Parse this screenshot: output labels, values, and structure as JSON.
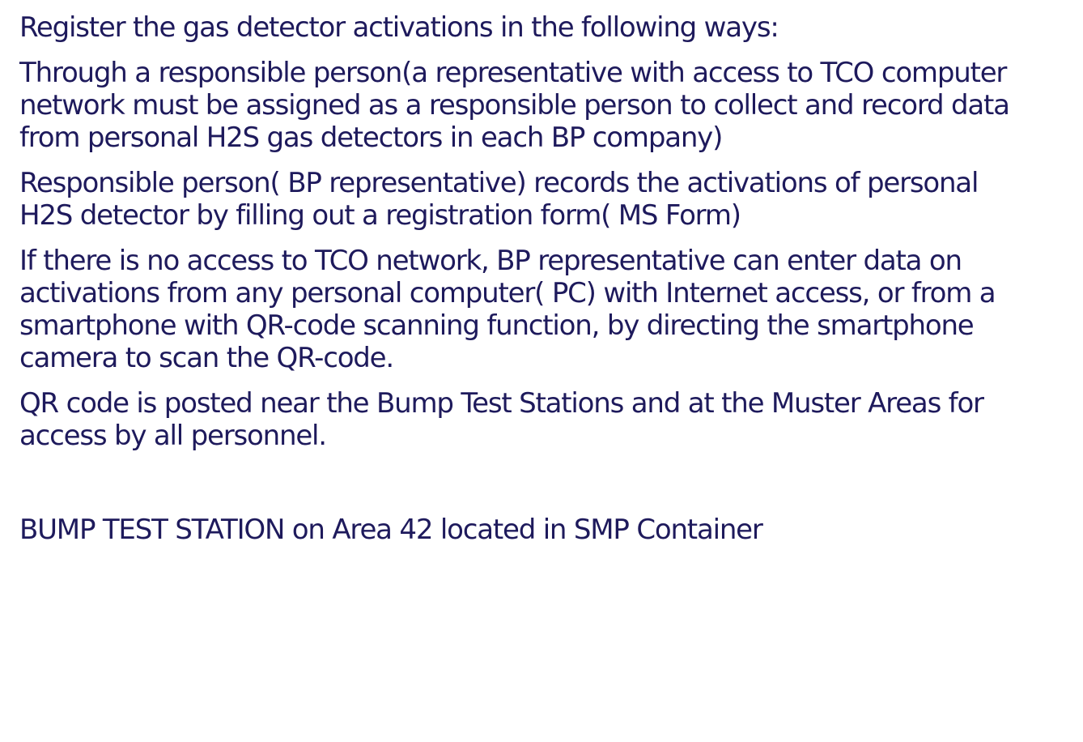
{
  "document": {
    "heading": "Register the gas detector activations in the following ways:",
    "paragraphs": [
      "Through a responsible person(a representative with access to TCO computer\nnetwork must be assigned as a responsible person to collect and record data\nfrom personal H2S gas detectors in each BP company)",
      "Responsible person( BP representative) records the activations of personal\nH2S detector by filling out a registration form( MS Form)",
      "If there is no access to TCO network, BP representative can enter data on\nactivations from any personal computer( PC) with Internet access, or from a\nsmartphone with QR-code scanning function, by directing the smartphone\ncamera to scan the QR-code.",
      "QR code is posted near the Bump Test Stations and at the Muster Areas for\naccess by all personnel."
    ],
    "caption": "BUMP TEST STATION on Area 42 located in SMP Container"
  }
}
